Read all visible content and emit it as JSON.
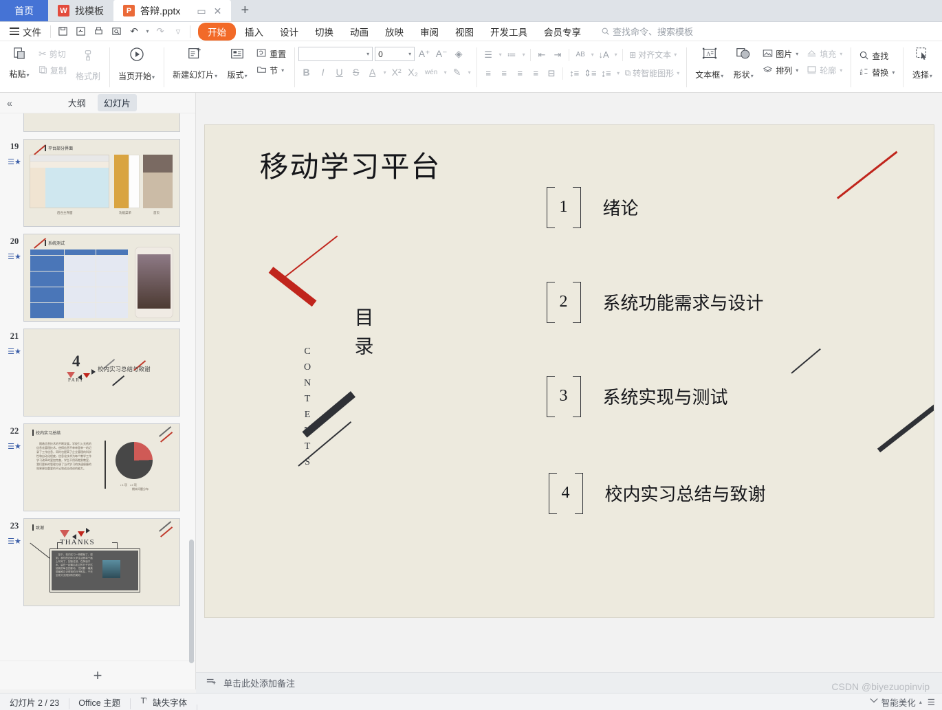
{
  "tabs": {
    "home_label": "首页",
    "items": [
      {
        "label": "找模板",
        "icon": "template-icon",
        "badge": "W",
        "active": false
      },
      {
        "label": "答辩.pptx",
        "icon": "pptx-file-icon",
        "badge": "P",
        "active": true
      }
    ],
    "new_tab": "+",
    "tab_actions": {
      "restore": "▭",
      "close": "✕"
    }
  },
  "menu": {
    "file_label": "文件",
    "quick_access": [
      "save-icon",
      "save-as-icon",
      "print-icon",
      "print-preview-icon",
      "undo-icon",
      "redo-icon",
      "customize-icon"
    ],
    "items": [
      {
        "label": "开始",
        "selected": true
      },
      {
        "label": "插入",
        "selected": false
      },
      {
        "label": "设计",
        "selected": false
      },
      {
        "label": "切换",
        "selected": false
      },
      {
        "label": "动画",
        "selected": false
      },
      {
        "label": "放映",
        "selected": false
      },
      {
        "label": "审阅",
        "selected": false
      },
      {
        "label": "视图",
        "selected": false
      },
      {
        "label": "开发工具",
        "selected": false
      },
      {
        "label": "会员专享",
        "selected": false
      }
    ],
    "search_placeholder": "查找命令、搜索模板",
    "accent_color": "#f26a28"
  },
  "ribbon": {
    "clipboard": {
      "paste": "粘贴",
      "cut": "剪切",
      "copy": "复制",
      "format_painter": "格式刷"
    },
    "present": {
      "from_current": "当页开始"
    },
    "slides": {
      "new_slide": "新建幻灯片",
      "layout": "版式",
      "reset": "重置",
      "section": "节"
    },
    "font": {
      "name_value": "",
      "size_value": "0",
      "grow": "A+",
      "shrink": "A-",
      "clear_format": "清除格式",
      "bold": "B",
      "italic": "I",
      "underline": "U",
      "strike": "S",
      "font_color": "A",
      "superscript": "X²",
      "subscript": "X₂",
      "pinyin": "wén",
      "highlight": "highlight-icon"
    },
    "paragraph": {
      "align_text": "对齐文本",
      "smart_art": "转智能图形"
    },
    "insert": {
      "textbox": "文本框",
      "shape": "形状",
      "picture": "图片",
      "arrange": "排列",
      "fill": "填充",
      "outline": "轮廓"
    },
    "editing": {
      "find": "查找",
      "replace": "替换",
      "select": "选择"
    }
  },
  "left_panel": {
    "collapse_icon": "«",
    "tabs": [
      {
        "label": "大纲",
        "selected": false
      },
      {
        "label": "幻灯片",
        "selected": true
      }
    ],
    "add_slide": "+",
    "slides": [
      {
        "number": "19",
        "title": "平台部分界面",
        "captions": [
          "后台主界面",
          "功能菜单",
          "首页"
        ]
      },
      {
        "number": "20",
        "title": "系统测试"
      },
      {
        "number": "21",
        "title": "",
        "big_number": "4",
        "part_label": "PART",
        "text": "校内实习总结与致谢"
      },
      {
        "number": "22",
        "title": "校内实习总结",
        "chart_caption": "期末问题分布"
      },
      {
        "number": "23",
        "title": "致谢",
        "thanks": "THANKS"
      }
    ]
  },
  "slide": {
    "title": "移动学习平台",
    "contents_cn": "目  录",
    "contents_en": [
      "C",
      "O",
      "N",
      "T",
      "E",
      "N",
      "T",
      "S"
    ],
    "items": [
      {
        "number": "1",
        "label": "绪论"
      },
      {
        "number": "2",
        "label": "系统功能需求与设计"
      },
      {
        "number": "3",
        "label": "系统实现与测试"
      },
      {
        "number": "4",
        "label": "校内实习总结与致谢"
      }
    ],
    "background_color": "#edeade",
    "accent_red": "#c0251c",
    "accent_dark": "#2f3136"
  },
  "notes": {
    "placeholder": "单击此处添加备注",
    "icon": "notes-icon"
  },
  "status": {
    "slide_counter": "幻灯片 2 / 23",
    "theme": "Office 主题",
    "missing_font": "缺失字体",
    "beautify": "智能美化"
  },
  "watermark": "CSDN @biyezuopinvip"
}
